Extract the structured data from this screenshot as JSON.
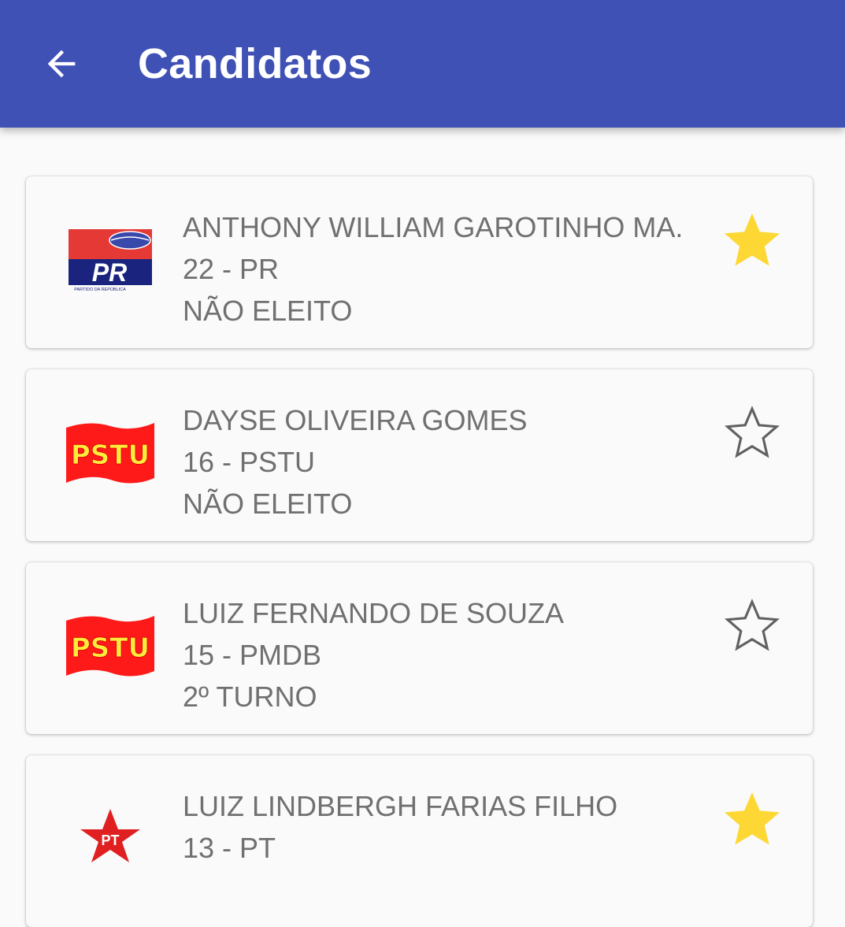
{
  "appbar": {
    "title": "Candidatos",
    "back_icon": "arrow-back-icon",
    "color": "#3f51b5"
  },
  "candidates": [
    {
      "name": "ANTHONY WILLIAM GAROTINHO MA.",
      "number_party": "22 - PR",
      "status": "NÃO ELEITO",
      "logo": "PR",
      "logo_subtext": "PARTIDO DA REPÚBLICA",
      "favorite": true
    },
    {
      "name": "DAYSE OLIVEIRA GOMES",
      "number_party": "16 - PSTU",
      "status": "NÃO ELEITO",
      "logo": "PSTU",
      "favorite": false
    },
    {
      "name": "LUIZ FERNANDO DE SOUZA",
      "number_party": "15 - PMDB",
      "status": "2º TURNO",
      "logo": "PSTU",
      "favorite": false
    },
    {
      "name": "LUIZ LINDBERGH FARIAS FILHO",
      "number_party": "13 - PT",
      "status": "",
      "logo": "PT",
      "favorite": true
    }
  ],
  "colors": {
    "star_filled": "#fdd835",
    "star_outline": "#616161",
    "text": "#707070"
  }
}
